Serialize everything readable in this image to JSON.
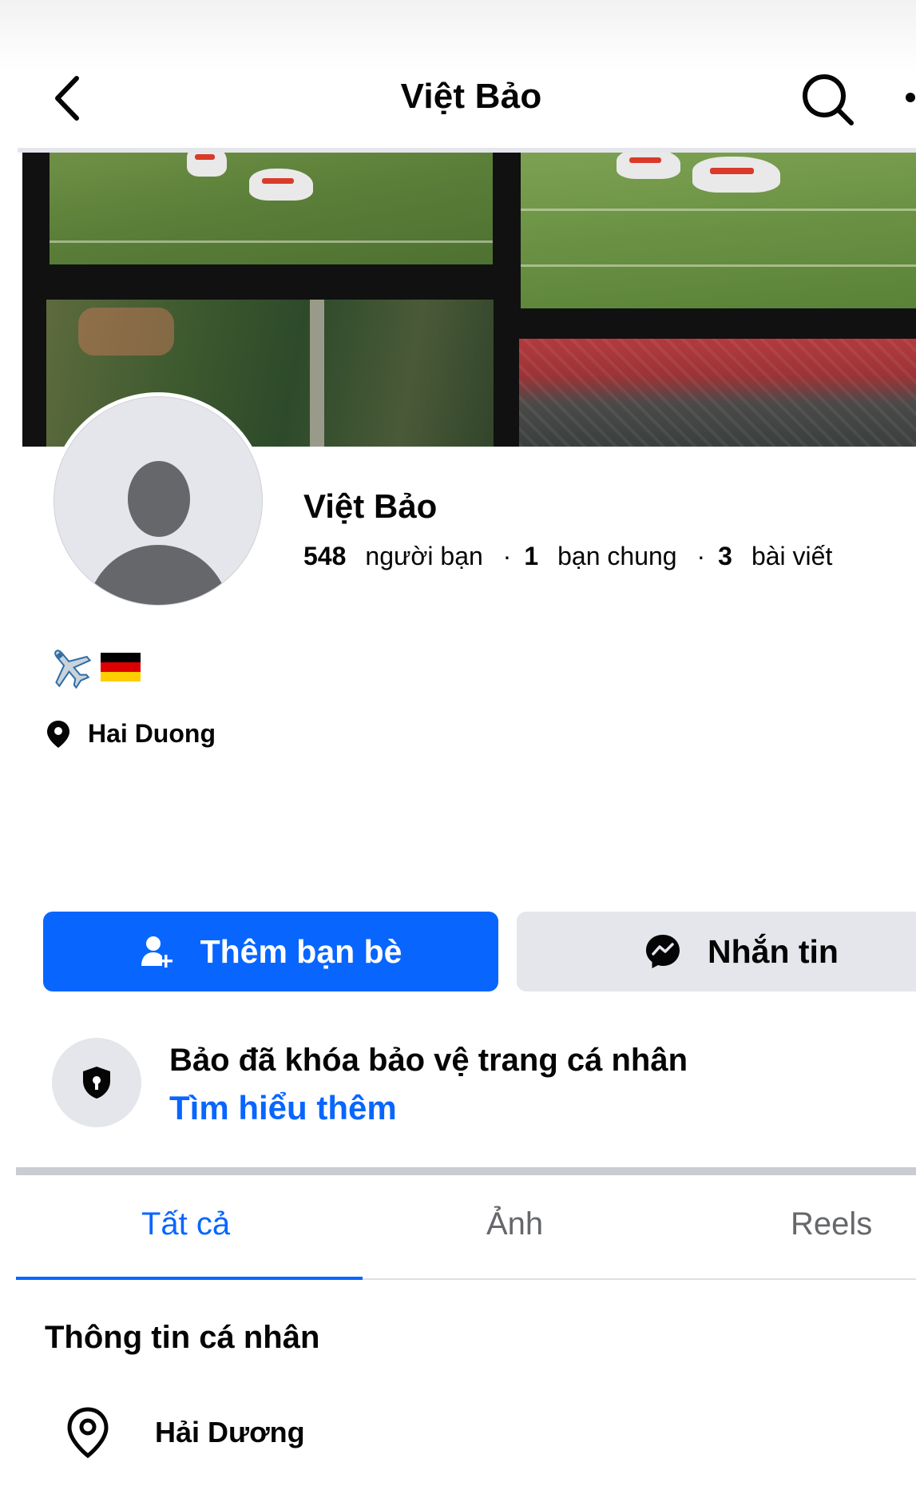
{
  "header": {
    "title": "Việt Bảo"
  },
  "profile": {
    "name": "Việt Bảo",
    "stats": {
      "friends_count": "548",
      "friends_label": "người bạn",
      "mutual_count": "1",
      "mutual_label": "bạn chung",
      "posts_count": "3",
      "posts_label": "bài viết",
      "separator": "·"
    },
    "bio": {
      "emoji_plane": "✈️",
      "emoji_flag": "🇩🇪"
    },
    "location": "Hai Duong"
  },
  "actions": {
    "add_friend": "Thêm bạn bè",
    "message": "Nhắn tin"
  },
  "lock_notice": {
    "title": "Bảo đã khóa bảo vệ trang cá nhân",
    "link": "Tìm hiểu thêm"
  },
  "tabs": [
    {
      "label": "Tất cả",
      "active": true
    },
    {
      "label": "Ảnh",
      "active": false
    },
    {
      "label": "Reels",
      "active": false
    }
  ],
  "personal_info": {
    "title": "Thông tin cá nhân",
    "location": "Hải Dương"
  },
  "colors": {
    "accent": "#0866ff",
    "secondary_button": "#e4e6eb",
    "muted_text": "#65676b"
  },
  "icons": [
    "back-arrow-icon",
    "search-icon",
    "more-icon",
    "location-pin-icon",
    "add-friend-icon",
    "messenger-icon",
    "shield-lock-icon",
    "location-outline-icon"
  ]
}
